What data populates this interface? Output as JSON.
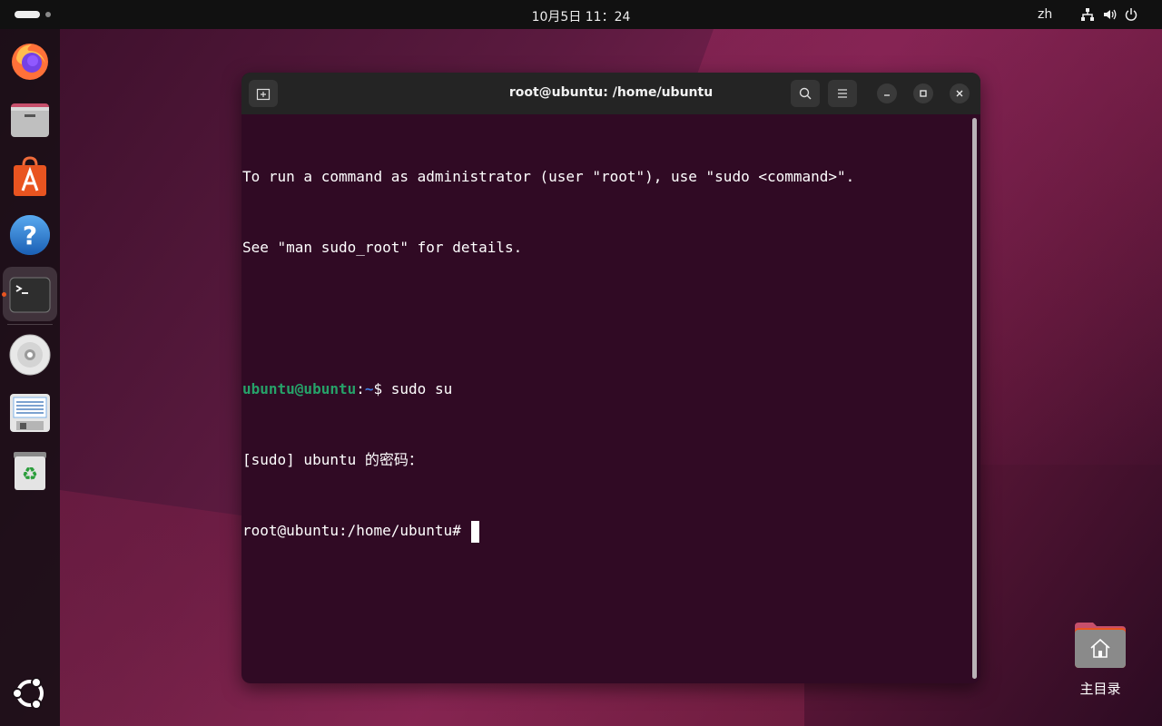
{
  "topbar": {
    "clock": "10月5日  11：24",
    "language": "zh",
    "tray_icons": [
      "network-icon",
      "volume-icon",
      "power-icon"
    ]
  },
  "dock": {
    "items": [
      {
        "name": "firefox-icon"
      },
      {
        "name": "files-icon"
      },
      {
        "name": "app-center-icon"
      },
      {
        "name": "help-icon"
      },
      {
        "name": "terminal-icon",
        "active": true
      },
      {
        "name": "disc-icon"
      },
      {
        "name": "text-editor-icon"
      },
      {
        "name": "trash-icon"
      }
    ],
    "show_apps": "ubuntu-logo-icon"
  },
  "window": {
    "title": "root@ubuntu: /home/ubuntu",
    "terminal": {
      "line1": "To run a command as administrator (user \"root\"), use \"sudo <command>\".",
      "line2": "See \"man sudo_root\" for details.",
      "prompt_user": "ubuntu@ubuntu",
      "prompt_sep": ":",
      "prompt_path": "~",
      "prompt_cmd": "$ sudo su",
      "line4": "[sudo] ubuntu 的密码：",
      "line5": "root@ubuntu:/home/ubuntu# "
    }
  },
  "desktop": {
    "home_label": "主目录"
  },
  "colors": {
    "terminal_bg": "#300a24",
    "prompt_green": "#26a269",
    "prompt_blue": "#3f7de0",
    "accent_orange": "#e95420"
  }
}
